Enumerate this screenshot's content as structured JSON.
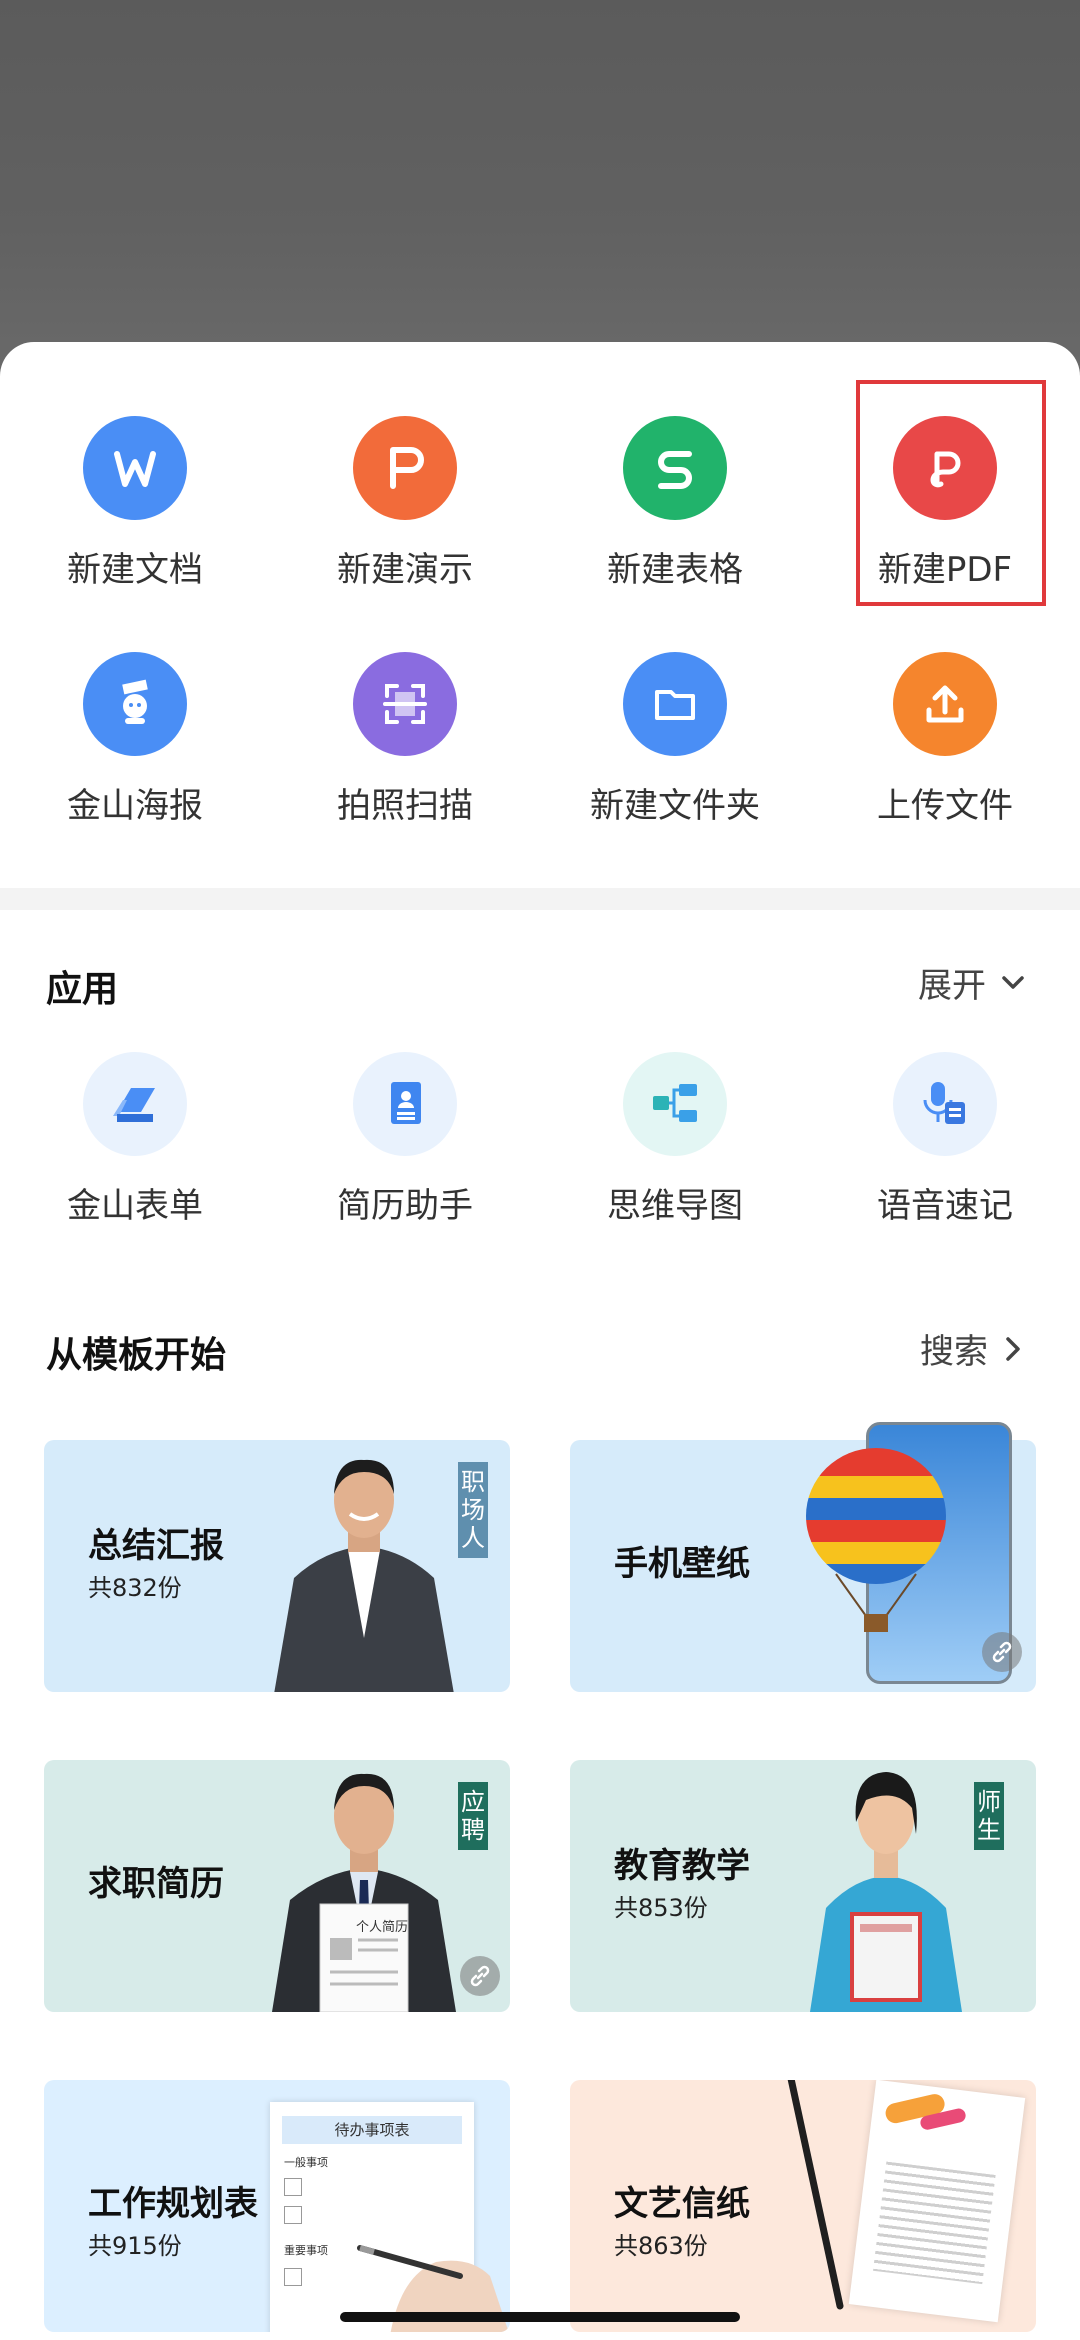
{
  "quick_actions": [
    {
      "label": "新建文档",
      "icon": "word-icon",
      "color": "#4a8ef5",
      "glyph": "W"
    },
    {
      "label": "新建演示",
      "icon": "presentation-icon",
      "color": "#f26b3a",
      "glyph": "P"
    },
    {
      "label": "新建表格",
      "icon": "spreadsheet-icon",
      "color": "#21b36b",
      "glyph": "S"
    },
    {
      "label": "新建PDF",
      "icon": "pdf-icon",
      "color": "#e84848",
      "glyph": "P"
    },
    {
      "label": "金山海报",
      "icon": "poster-icon",
      "color": "#4a8ef5"
    },
    {
      "label": "拍照扫描",
      "icon": "scan-icon",
      "color": "#8a6ce0"
    },
    {
      "label": "新建文件夹",
      "icon": "folder-icon",
      "color": "#4a8ef5"
    },
    {
      "label": "上传文件",
      "icon": "upload-icon",
      "color": "#f5852d"
    }
  ],
  "apps_section": {
    "title": "应用",
    "action": "展开",
    "items": [
      {
        "label": "金山表单",
        "icon": "form-icon"
      },
      {
        "label": "简历助手",
        "icon": "resume-icon"
      },
      {
        "label": "思维导图",
        "icon": "mindmap-icon"
      },
      {
        "label": "语音速记",
        "icon": "voice-note-icon"
      }
    ]
  },
  "templates_section": {
    "title": "从模板开始",
    "action": "搜索",
    "cards": [
      {
        "title": "总结汇报",
        "count": "共832份",
        "tag": "职场人",
        "bg": "#d6ebfa"
      },
      {
        "title": "手机壁纸",
        "count": "",
        "tag": "",
        "bg": "#d6ebfa"
      },
      {
        "title": "求职简历",
        "count": "",
        "tag": "应聘",
        "bg": "#d7ebe9"
      },
      {
        "title": "教育教学",
        "count": "共853份",
        "tag": "师生",
        "bg": "#d7ebe9"
      },
      {
        "title": "工作规划表",
        "count": "共915份",
        "tag": "",
        "bg": "#dcefff"
      },
      {
        "title": "文艺信纸",
        "count": "共863份",
        "tag": "",
        "bg": "#fde8dc"
      }
    ],
    "doc_preview": {
      "heading": "待办事项表",
      "row1": "一般事项",
      "row2": "重要事项"
    },
    "resume_sheet": "个人简历"
  },
  "colors": {
    "highlight": "#e0393b",
    "accent": "#4a8ef5"
  }
}
